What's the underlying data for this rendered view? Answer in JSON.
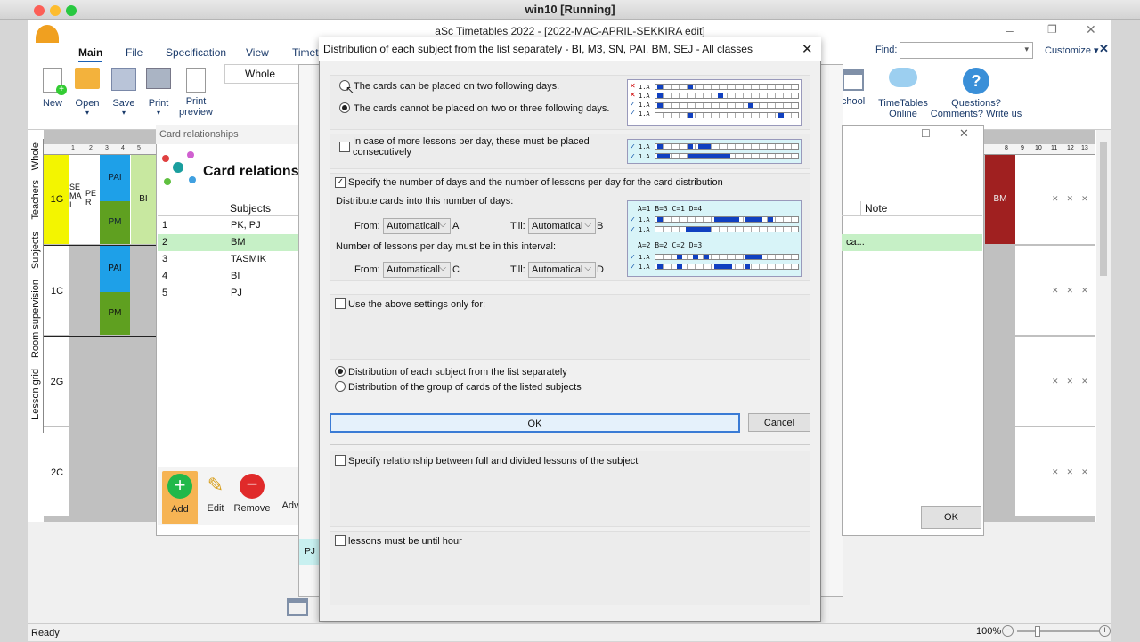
{
  "host": {
    "title": "win10 [Running]"
  },
  "app": {
    "title": "aSc Timetables 2022  - [2022-MAC-APRIL-SEKKIRA edit]",
    "tabs": [
      "Main",
      "File",
      "Specification",
      "View",
      "Timeta"
    ],
    "find_label": "Find:",
    "customize_label": "Customize",
    "ribbon": {
      "new": "New",
      "open": "Open",
      "save": "Save",
      "print": "Print",
      "print_preview_1": "Print",
      "print_preview_2": "preview",
      "whole": "Whole",
      "school": "chool",
      "tt_online_1": "TimeTables",
      "tt_online_2": "Online",
      "questions_1": "Questions?",
      "questions_2": "Comments? Write us"
    },
    "side_tabs": [
      "Whole",
      "Teachers",
      "Subjects",
      "Room supervision",
      "Lesson grid"
    ],
    "classes": [
      "1G",
      "1C",
      "2G",
      "2C"
    ],
    "col_numbers": [
      "1",
      "2",
      "3",
      "4",
      "5"
    ],
    "right_col_numbers": [
      "8",
      "9",
      "10",
      "11",
      "12",
      "13"
    ],
    "grid_cells": {
      "se_mai": "SE MA I",
      "pe_r": "PE R",
      "pai": "PAI",
      "pm": "PM",
      "bi": "BI",
      "bm": "BM"
    },
    "status": "Ready",
    "zoom": "100%"
  },
  "card_rel": {
    "window_title": "Card relationships",
    "heading": "Card relations",
    "col_subjects": "Subjects",
    "rows": [
      {
        "n": "1",
        "s": "PK, PJ"
      },
      {
        "n": "2",
        "s": "BM"
      },
      {
        "n": "3",
        "s": "TASMIK"
      },
      {
        "n": "4",
        "s": "BI"
      },
      {
        "n": "5",
        "s": "PJ"
      }
    ],
    "add": "Add",
    "edit": "Edit",
    "remove": "Remove",
    "adv": "Adv",
    "pj": "PJ"
  },
  "right_win": {
    "note": "Note",
    "cell": "ca...",
    "ok": "OK"
  },
  "dialog": {
    "title": "Distribution of each subject from the list separately - BI, M3, SN, PAI, BM, SEJ - All classes",
    "opt_following": "The cards can be placed on two following days.",
    "opt_not_following": "The cards cannot be placed on two or three following days.",
    "consecutive": "In case of more lessons per day, these must be placed consecutively",
    "specify_days": "Specify the number of days and the number of lessons per day for the card distribution",
    "distribute_days": "Distribute cards into this number of days:",
    "from": "From:",
    "till": "Till:",
    "auto": "Automaticall",
    "auto2": "Automatical",
    "a": "A",
    "b": "B",
    "c": "C",
    "d": "D",
    "lessons_interval": "Number of lessons per day must be in this interval:",
    "use_only": "Use the above settings only for:",
    "dist_separately": "Distribution of each subject from the list separately",
    "dist_group": "Distribution of the group of cards of the listed subjects",
    "ok": "OK",
    "cancel": "Cancel",
    "full_divided": "Specify relationship between full and divided lessons of the subject",
    "until_hour": "lessons must be until hour",
    "legend1": "A=1 B=3 C=1 D=4",
    "legend2": "A=2 B=2 C=2 D=3",
    "tag": "1.A"
  }
}
